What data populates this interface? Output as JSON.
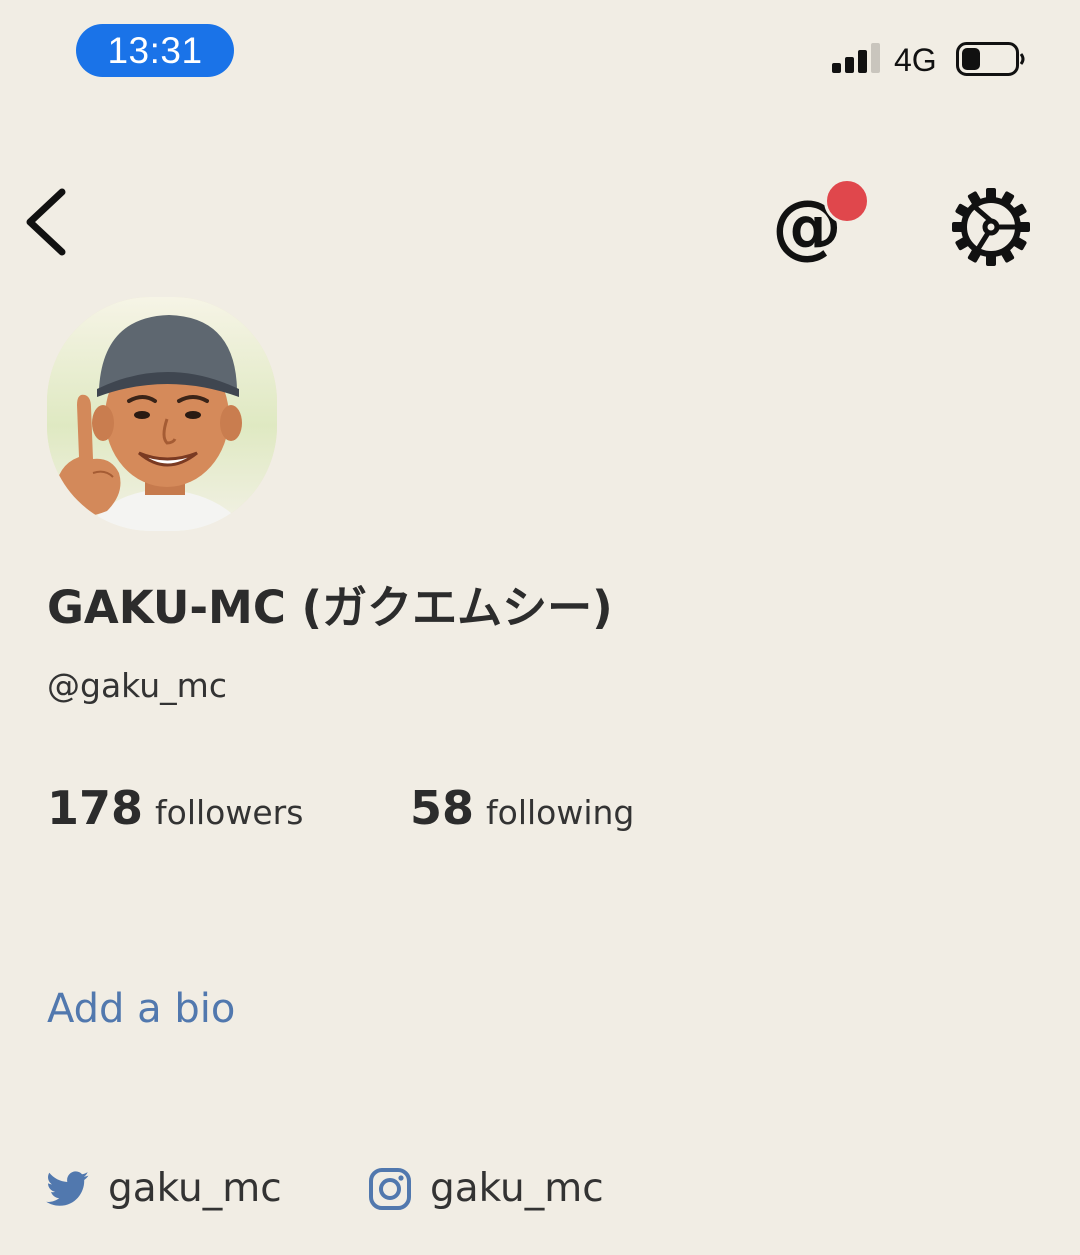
{
  "status_bar": {
    "time": "13:31",
    "network": "4G",
    "battery_level": 0.35,
    "accent_color": "#1a73e8"
  },
  "nav": {
    "back_icon": "chevron-left-icon",
    "mention_icon": "at-sign-icon",
    "mention_glyph": "@",
    "notification_color": "#e0474c",
    "settings_icon": "gear-icon"
  },
  "profile": {
    "avatar": "avatar",
    "display_name": "GAKU-MC (ガクエムシー)",
    "username": "@gaku_mc",
    "followers_count": "178",
    "followers_label": "followers",
    "following_count": "58",
    "following_label": "following",
    "add_bio_label": "Add a bio",
    "link_color": "#5178ae"
  },
  "social": {
    "twitter": {
      "icon": "twitter-icon",
      "handle": "gaku_mc"
    },
    "instagram": {
      "icon": "instagram-icon",
      "handle": "gaku_mc"
    }
  }
}
